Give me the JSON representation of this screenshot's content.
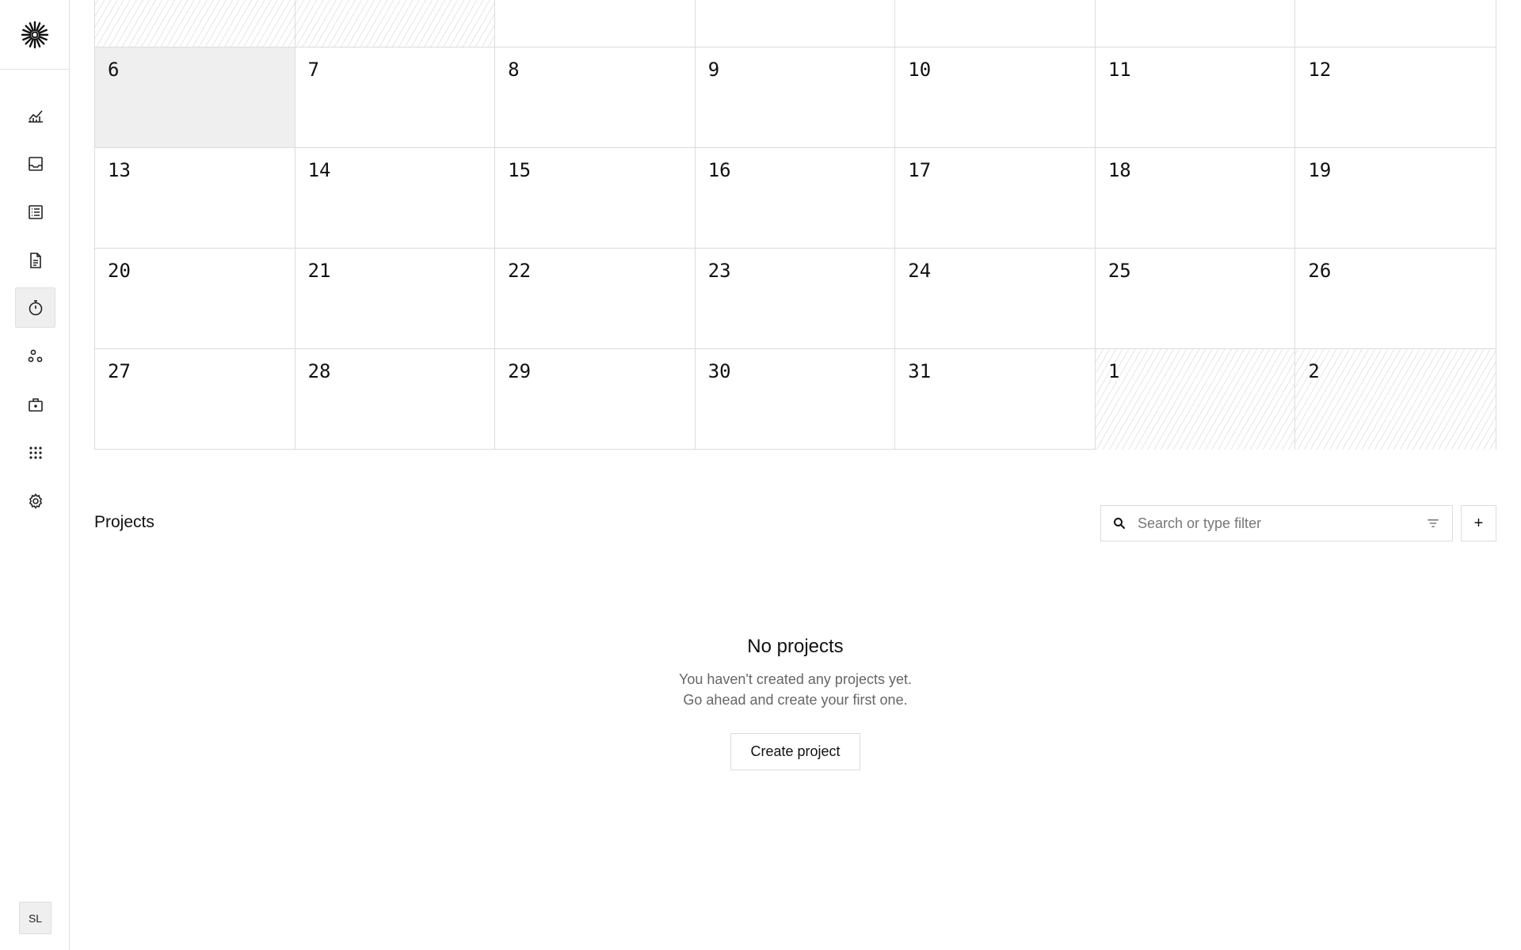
{
  "sidebar": {
    "logo_icon": "asterisk-logo-icon",
    "items": [
      {
        "name": "analytics",
        "icon": "chart-icon",
        "active": false
      },
      {
        "name": "inbox",
        "icon": "inbox-icon",
        "active": false
      },
      {
        "name": "list",
        "icon": "list-icon",
        "active": false
      },
      {
        "name": "documents",
        "icon": "document-icon",
        "active": false
      },
      {
        "name": "time-tracking",
        "icon": "stopwatch-icon",
        "active": true
      },
      {
        "name": "customers",
        "icon": "people-icon",
        "active": false
      },
      {
        "name": "vault",
        "icon": "briefcase-icon",
        "active": false
      },
      {
        "name": "apps",
        "icon": "grid-icon",
        "active": false
      },
      {
        "name": "settings",
        "icon": "gear-icon",
        "active": false
      }
    ],
    "avatar_initials": "SL"
  },
  "calendar": {
    "weeks": [
      [
        {
          "day": "",
          "outside": true
        },
        {
          "day": "",
          "outside": true
        },
        {
          "day": ""
        },
        {
          "day": ""
        },
        {
          "day": ""
        },
        {
          "day": ""
        },
        {
          "day": ""
        }
      ],
      [
        {
          "day": "6",
          "today": true
        },
        {
          "day": "7"
        },
        {
          "day": "8"
        },
        {
          "day": "9"
        },
        {
          "day": "10"
        },
        {
          "day": "11"
        },
        {
          "day": "12"
        }
      ],
      [
        {
          "day": "13"
        },
        {
          "day": "14"
        },
        {
          "day": "15"
        },
        {
          "day": "16"
        },
        {
          "day": "17"
        },
        {
          "day": "18"
        },
        {
          "day": "19"
        }
      ],
      [
        {
          "day": "20"
        },
        {
          "day": "21"
        },
        {
          "day": "22"
        },
        {
          "day": "23"
        },
        {
          "day": "24"
        },
        {
          "day": "25"
        },
        {
          "day": "26"
        }
      ],
      [
        {
          "day": "27"
        },
        {
          "day": "28"
        },
        {
          "day": "29"
        },
        {
          "day": "30"
        },
        {
          "day": "31"
        },
        {
          "day": "1",
          "outside": true
        },
        {
          "day": "2",
          "outside": true
        }
      ]
    ]
  },
  "projects": {
    "title": "Projects",
    "search_placeholder": "Search or type filter",
    "add_label": "+",
    "empty": {
      "title": "No projects",
      "line1": "You haven't created any projects yet.",
      "line2": "Go ahead and create your first one.",
      "button": "Create project"
    }
  }
}
